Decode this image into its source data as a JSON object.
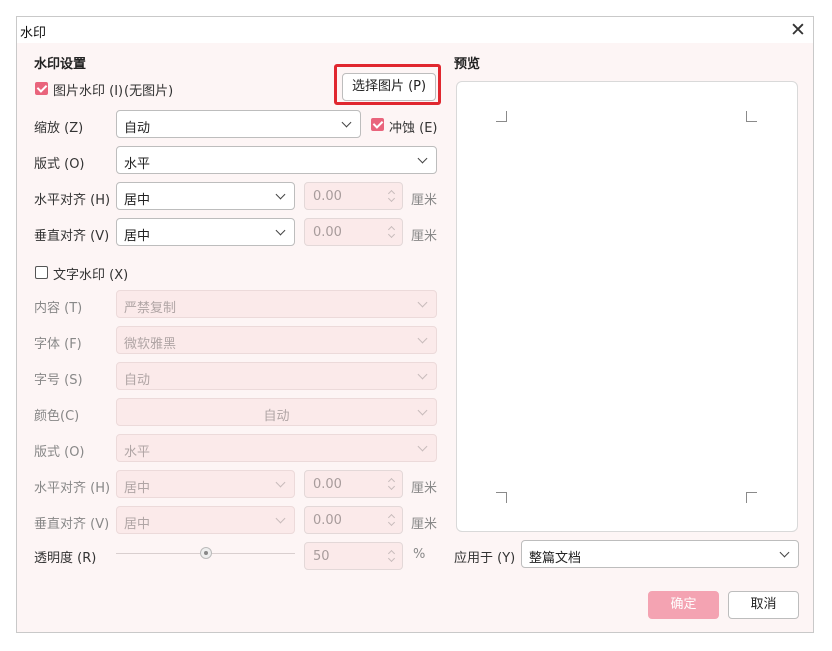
{
  "dialog": {
    "title": "水印",
    "close_glyph": "✕"
  },
  "settings": {
    "section_title": "水印设置",
    "image_watermark": {
      "label": "图片水印 (I)",
      "status": "(无图片)",
      "checked": true
    },
    "select_image_button": "选择图片 (P)",
    "scale": {
      "label": "缩放 (Z)",
      "value": "自动"
    },
    "erode": {
      "label": "冲蚀 (E)",
      "checked": true
    },
    "image_layout": {
      "label": "版式 (O)",
      "value": "水平"
    },
    "image_h_align": {
      "label": "水平对齐 (H)",
      "value": "居中",
      "offset": "0.00",
      "unit": "厘米"
    },
    "image_v_align": {
      "label": "垂直对齐 (V)",
      "value": "居中",
      "offset": "0.00",
      "unit": "厘米"
    },
    "text_watermark": {
      "label": "文字水印 (X)",
      "checked": false
    },
    "content": {
      "label": "内容 (T)",
      "value": "严禁复制"
    },
    "font": {
      "label": "字体 (F)",
      "value": "微软雅黑"
    },
    "size": {
      "label": "字号 (S)",
      "value": "自动"
    },
    "color": {
      "label": "颜色(C)",
      "value": "自动"
    },
    "text_layout": {
      "label": "版式 (O)",
      "value": "水平"
    },
    "text_h_align": {
      "label": "水平对齐 (H)",
      "value": "居中",
      "offset": "0.00",
      "unit": "厘米"
    },
    "text_v_align": {
      "label": "垂直对齐 (V)",
      "value": "居中",
      "offset": "0.00",
      "unit": "厘米"
    },
    "transparency": {
      "label": "透明度 (R)",
      "value": "50",
      "unit": "%"
    }
  },
  "preview": {
    "section_title": "预览",
    "apply_to": {
      "label": "应用于 (Y)",
      "value": "整篇文档"
    }
  },
  "footer": {
    "ok": "确定",
    "cancel": "取消"
  },
  "colors": {
    "accent": "#e9647c",
    "highlight": "#e0272f",
    "primary_button": "#f4a3b2"
  }
}
